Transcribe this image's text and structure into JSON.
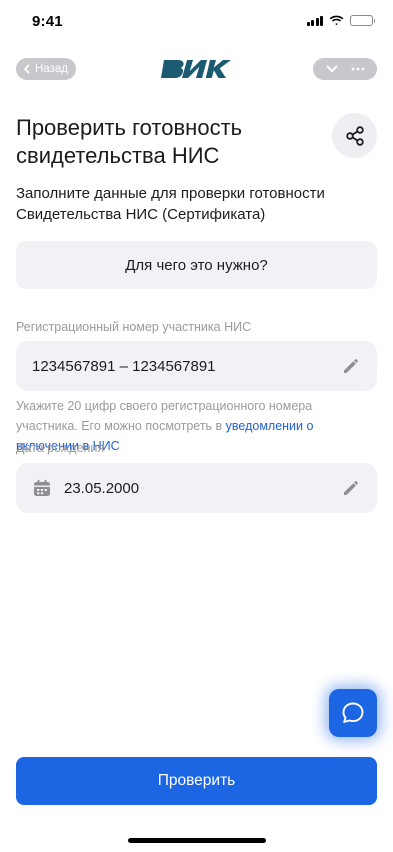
{
  "status_bar": {
    "time": "9:41"
  },
  "nav": {
    "back_label": "Назад",
    "logo_text": "ВИК"
  },
  "page": {
    "title": "Проверить готовность свидетельства НИС",
    "subtitle": "Заполните данные для проверки готовности Свидетельства НИС (Сертификата)",
    "why_label": "Для чего это нужно?"
  },
  "form": {
    "reg_number": {
      "label": "Регистрационный номер участника НИС",
      "value": "1234567891 – 1234567891",
      "hint_text": "Укажите 20 цифр своего регистрационного номера участника. Его можно посмотреть в ",
      "hint_link": "уведомлении о включении в НИС"
    },
    "birth_date": {
      "label": "Дата рождения",
      "value": "23.05.2000"
    }
  },
  "submit_label": "Проверить",
  "colors": {
    "accent": "#1d66e3",
    "field_bg": "#f2f2f6",
    "label_gray": "#9a9aa0",
    "logo": "#1b5a70"
  }
}
